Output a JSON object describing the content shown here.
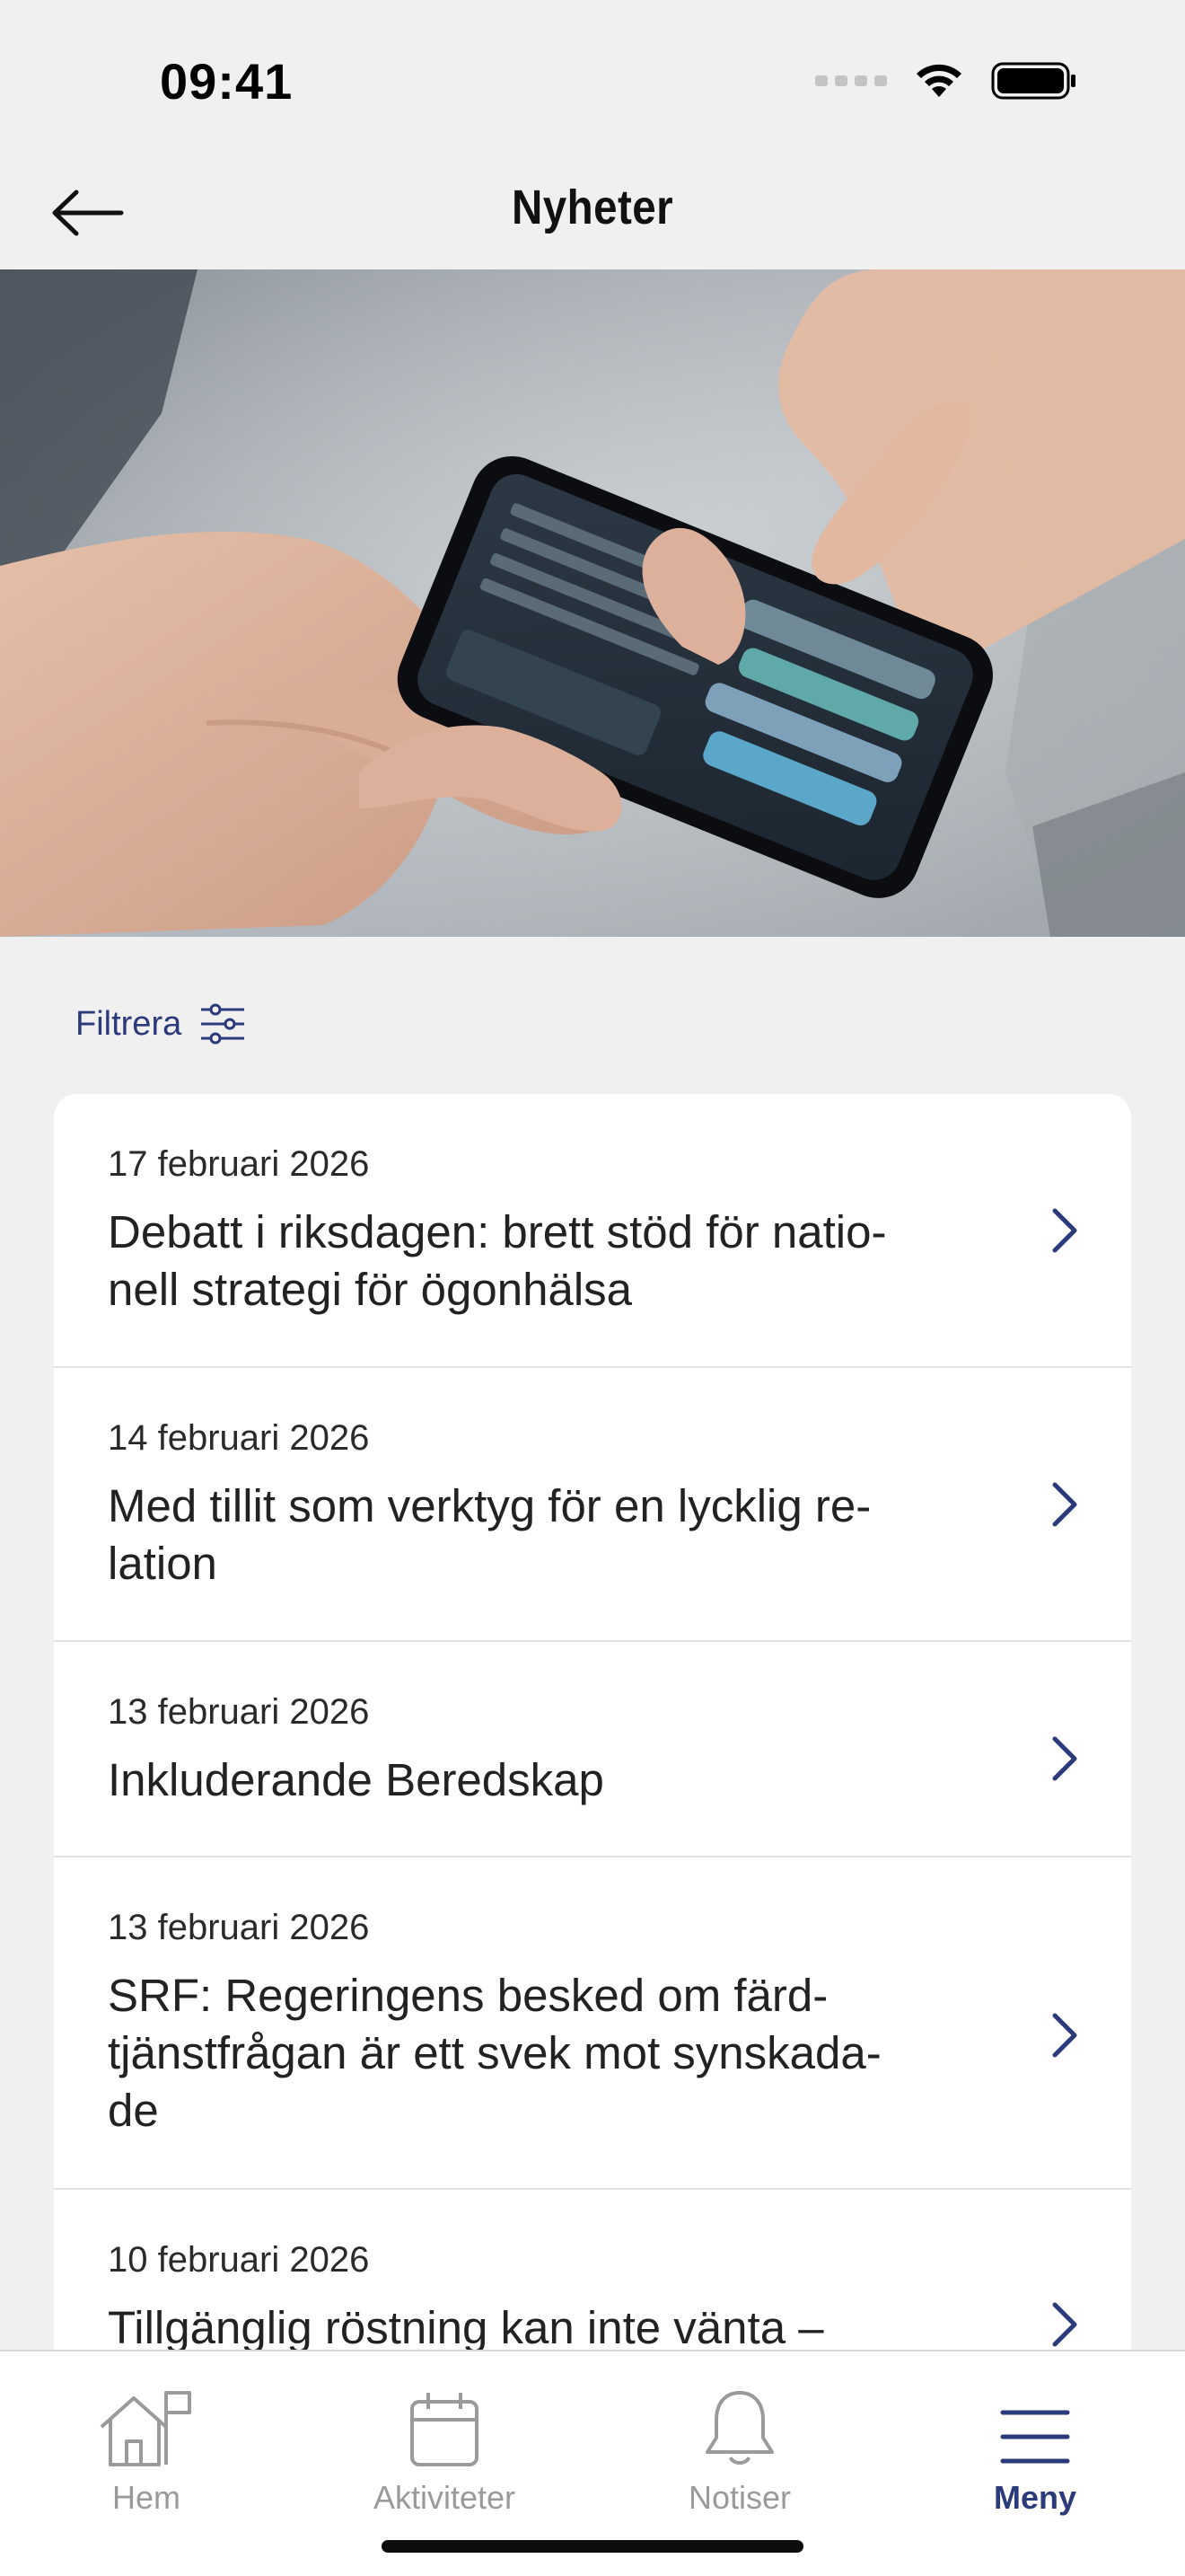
{
  "status_bar": {
    "time": "09:41"
  },
  "header": {
    "title": "Nyheter",
    "back_icon": "arrow-left-icon"
  },
  "hero": {
    "icon": "hero-photo-hands-phone"
  },
  "filter": {
    "label": "Filtrera",
    "icon": "sliders-icon"
  },
  "news": [
    {
      "date": "17 februari 2026",
      "title_lines": [
        "Debatt i riksdagen: brett stöd för natio-",
        "nell strategi för ögonhälsa"
      ]
    },
    {
      "date": "14 februari 2026",
      "title_lines": [
        "Med tillit som verktyg för en lycklig re-",
        "lation"
      ]
    },
    {
      "date": "13 februari 2026",
      "title_lines": [
        "Inkluderande Beredskap"
      ]
    },
    {
      "date": "13 februari 2026",
      "title_lines": [
        "SRF: Regeringens besked om färd-",
        "tjänstfrågan är ett svek mot synskada-",
        "de"
      ]
    },
    {
      "date": "10 februari 2026",
      "title_lines": [
        "Tillgänglig röstning kan inte vänta –"
      ]
    }
  ],
  "tabs": [
    {
      "label": "Hem",
      "icon": "home-flag-icon",
      "active": false
    },
    {
      "label": "Aktiviteter",
      "icon": "calendar-icon",
      "active": false
    },
    {
      "label": "Notiser",
      "icon": "bell-icon",
      "active": false
    },
    {
      "label": "Meny",
      "icon": "hamburger-menu-icon",
      "active": true
    }
  ],
  "colors": {
    "accent": "#2b3a7a",
    "background": "#f0f0f0",
    "inactive": "#9a9a9a"
  }
}
